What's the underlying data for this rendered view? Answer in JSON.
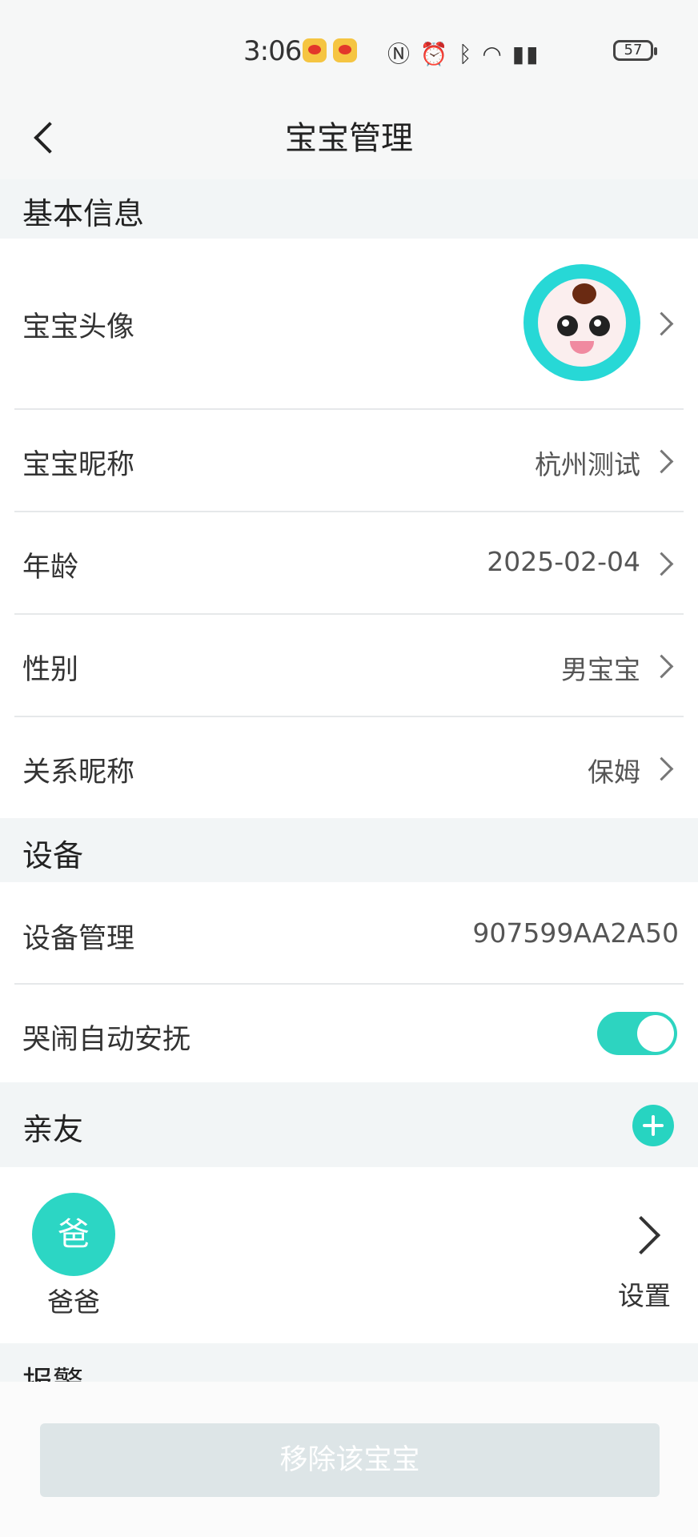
{
  "status_bar": {
    "time": "3:06",
    "battery": "57"
  },
  "header": {
    "title": "宝宝管理"
  },
  "sections": {
    "basic": {
      "title": "基本信息",
      "avatar_label": "宝宝头像",
      "rows": [
        {
          "label": "宝宝昵称",
          "value": "杭州测试"
        },
        {
          "label": "年龄",
          "value": "2025-02-04"
        },
        {
          "label": "性别",
          "value": "男宝宝"
        },
        {
          "label": "关系昵称",
          "value": "保姆"
        }
      ]
    },
    "device": {
      "title": "设备",
      "manage_label": "设备管理",
      "device_id": "907599AA2A50",
      "soothe_label": "哭闹自动安抚",
      "soothe_enabled": true
    },
    "family": {
      "title": "亲友",
      "members": [
        {
          "avatar_text": "爸",
          "name": "爸爸"
        }
      ],
      "settings_label": "设置"
    },
    "alarm": {
      "title": "报警"
    }
  },
  "footer": {
    "remove_button": "移除该宝宝"
  },
  "colors": {
    "accent": "#2dd4c0",
    "section_bg": "#f2f5f6",
    "disabled_button": "#dde5e7"
  }
}
